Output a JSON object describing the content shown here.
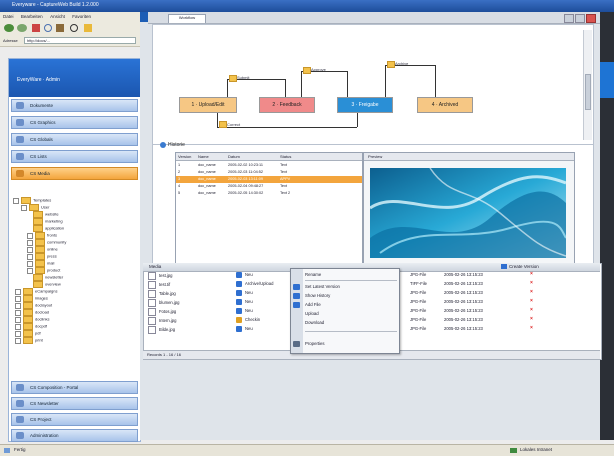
{
  "window": {
    "title": "Everyware - CaptureWeb Build 1.2.000"
  },
  "menu": [
    "Datei",
    "Bearbeiten",
    "Ansicht",
    "Favoriten"
  ],
  "address": {
    "label": "Adresse",
    "url": "http://docs/..."
  },
  "sidebar": {
    "header": "EveryWare · Admin",
    "top_buttons": [
      "Dokumente",
      "CS Graphics",
      "CS Globals",
      "CS Lists",
      "CS Media"
    ],
    "tree": [
      {
        "label": "Templates",
        "indent": 0
      },
      {
        "label": "User",
        "indent": 1
      },
      {
        "label": "website",
        "indent": 2
      },
      {
        "label": "marketing",
        "indent": 2
      },
      {
        "label": "application",
        "indent": 2
      },
      {
        "label": "fronts",
        "indent": 2
      },
      {
        "label": "community",
        "indent": 2
      },
      {
        "label": "online",
        "indent": 2
      },
      {
        "label": "press",
        "indent": 2
      },
      {
        "label": "mail",
        "indent": 2
      },
      {
        "label": "product",
        "indent": 2
      },
      {
        "label": "newsletter",
        "indent": 2
      },
      {
        "label": "overview",
        "indent": 2
      },
      {
        "label": "eCampaigns",
        "indent": 0
      },
      {
        "label": "images",
        "indent": 0
      },
      {
        "label": "doclayout",
        "indent": 0
      },
      {
        "label": "docload",
        "indent": 0
      },
      {
        "label": "doclinks",
        "indent": 0
      },
      {
        "label": "docpdf",
        "indent": 0
      },
      {
        "label": "pdf",
        "indent": 0
      },
      {
        "label": "print",
        "indent": 0
      }
    ],
    "bottom_buttons": [
      "CS Composition - Portal",
      "CS Newsletter",
      "CS Project",
      "Administration"
    ]
  },
  "tabs": {
    "active": "Workflow"
  },
  "workflow": {
    "nodes": [
      {
        "label": "1 · Upload/Edit",
        "color": "#f6c784"
      },
      {
        "label": "2 · Feedback",
        "color": "#f08a8a"
      },
      {
        "label": "3 · Freigabe",
        "color": "#2a8fd6"
      },
      {
        "label": "4 · Archived",
        "color": "#f6c784"
      }
    ],
    "edge_labels": [
      "Submit",
      "Approve",
      "Archive",
      "Correct"
    ]
  },
  "history": {
    "title": "Historie",
    "columns": [
      "Version",
      "Name",
      "Datum",
      "Status"
    ],
    "rows": [
      {
        "v": "1",
        "name": "doc_name",
        "date": "2005-02-02 10:23:11",
        "status": "Text",
        "selected": false
      },
      {
        "v": "2",
        "name": "doc_name",
        "date": "2005-02-03 11:04:52",
        "status": "Text",
        "selected": false
      },
      {
        "v": "3",
        "name": "doc_name",
        "date": "2005-02-03 13:11:09",
        "status": "APPV",
        "selected": true
      },
      {
        "v": "4",
        "name": "doc_name",
        "date": "2005-02-04 09:48:27",
        "status": "Text",
        "selected": false
      },
      {
        "v": "5",
        "name": "doc_name",
        "date": "2005-02-05 14:30:02",
        "status": "Text 2",
        "selected": false
      }
    ],
    "preview_title": "Preview"
  },
  "files": {
    "header": "Media",
    "status_right": "Create Version",
    "rows": [
      {
        "name": "test.jpg",
        "status": "Neu",
        "status_color": "#2f6fd0",
        "type": "JPG-File",
        "date": "2005-02-26 13:15:23"
      },
      {
        "name": "test.tif",
        "status": "Archive/Upload",
        "status_color": "#2f6fd0",
        "type": "TIFF-File",
        "date": "2005-02-26 13:15:23"
      },
      {
        "name": "Table.jpg",
        "status": "Neu",
        "status_color": "#2f6fd0",
        "type": "JPG-File",
        "date": "2005-02-26 13:15:23"
      },
      {
        "name": "blumen.jpg",
        "status": "Neu",
        "status_color": "#2f6fd0",
        "type": "JPG-File",
        "date": "2005-02-26 13:15:23"
      },
      {
        "name": "Fotos.jpg",
        "status": "Neu",
        "status_color": "#2f6fd0",
        "type": "JPG-File",
        "date": "2005-02-26 13:15:23"
      },
      {
        "name": "Intern.jpg",
        "status": "Checkin",
        "status_color": "#e0a020",
        "type": "JPG-File",
        "date": "2005-02-26 13:15:23"
      },
      {
        "name": "Bilde.jpg",
        "status": "Neu",
        "status_color": "#2f6fd0",
        "type": "JPG-File",
        "date": "2005-02-26 13:15:23"
      }
    ],
    "footer": "Records 1 - 16 / 16"
  },
  "context_menu": {
    "items": [
      {
        "label": "Rename",
        "icon": "rename-icon",
        "color": ""
      },
      {
        "label": "Set Latest Version",
        "icon": "version-icon",
        "color": "#2f6fd0"
      },
      {
        "label": "Show History",
        "icon": "history-icon",
        "color": "#2f6fd0"
      },
      {
        "label": "Add File",
        "icon": "add-file-icon",
        "color": "#2f6fd0"
      },
      {
        "label": "Upload",
        "icon": "upload-icon",
        "color": ""
      },
      {
        "label": "Download",
        "icon": "download-icon",
        "color": ""
      },
      {
        "label": "Properties",
        "icon": "properties-icon",
        "color": "#5a6c86"
      }
    ]
  },
  "statusbar": {
    "left": "Fertig",
    "right": "Lokales Intranet"
  }
}
